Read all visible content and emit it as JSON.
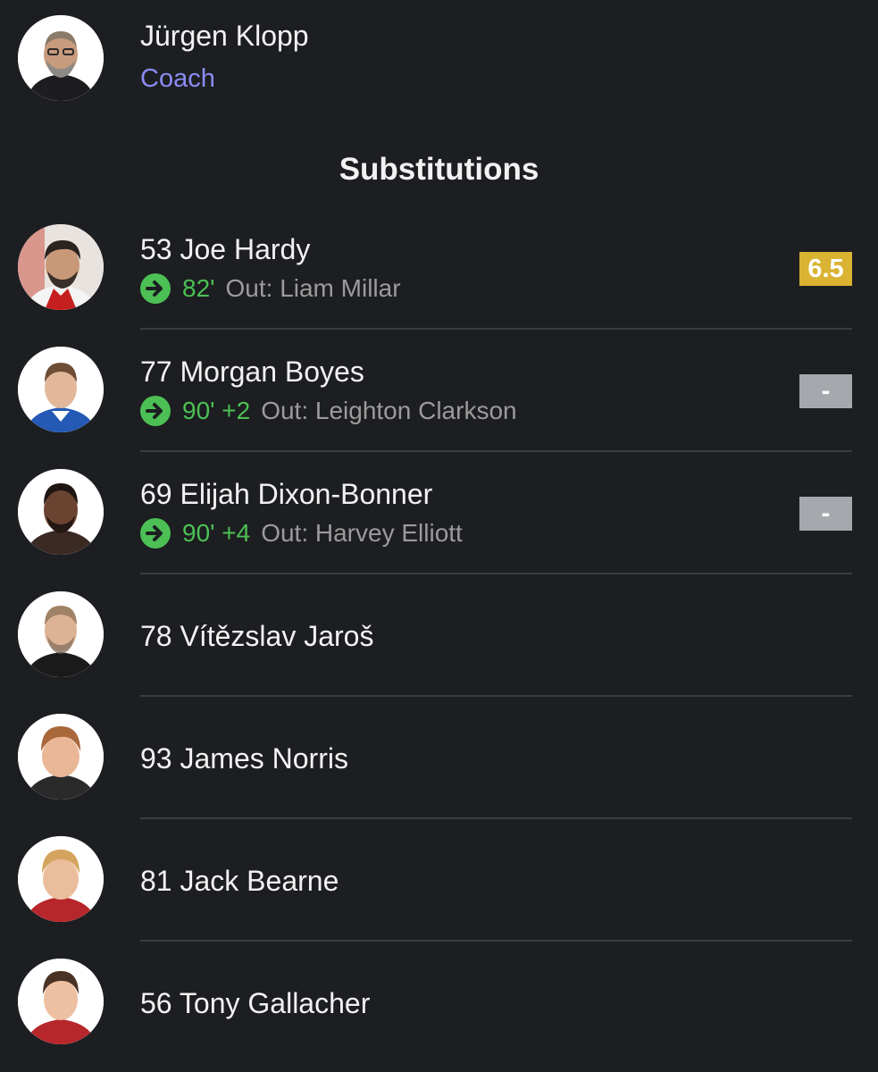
{
  "coach": {
    "name": "Jürgen Klopp",
    "role": "Coach",
    "avatar_icon": "coach-avatar"
  },
  "section_title": "Substitutions",
  "colors": {
    "background": "#1c1e21",
    "coach_role": "#8b8cf5",
    "sub_minute": "#4cc054",
    "sub_out": "#9b9b9b",
    "rating_good": "#d9b331",
    "rating_none": "#a5a8ad",
    "divider": "#3a3c40"
  },
  "players": [
    {
      "name": "53 Joe Hardy",
      "sub_icon": "substitution-in-arrow-icon",
      "minute": "82'",
      "out": "Out: Liam Millar",
      "rating": "6.5",
      "rating_color": "#d9b331"
    },
    {
      "name": "77 Morgan Boyes",
      "sub_icon": "substitution-in-arrow-icon",
      "minute": "90' +2",
      "out": "Out: Leighton Clarkson",
      "rating": "-",
      "rating_color": "#a5a8ad"
    },
    {
      "name": "69 Elijah Dixon-Bonner",
      "sub_icon": "substitution-in-arrow-icon",
      "minute": "90' +4",
      "out": "Out: Harvey Elliott",
      "rating": "-",
      "rating_color": "#a5a8ad"
    },
    {
      "name": "78 Vítězslav Jaroš"
    },
    {
      "name": "93 James Norris"
    },
    {
      "name": "81 Jack Bearne"
    },
    {
      "name": "56 Tony Gallacher"
    }
  ]
}
